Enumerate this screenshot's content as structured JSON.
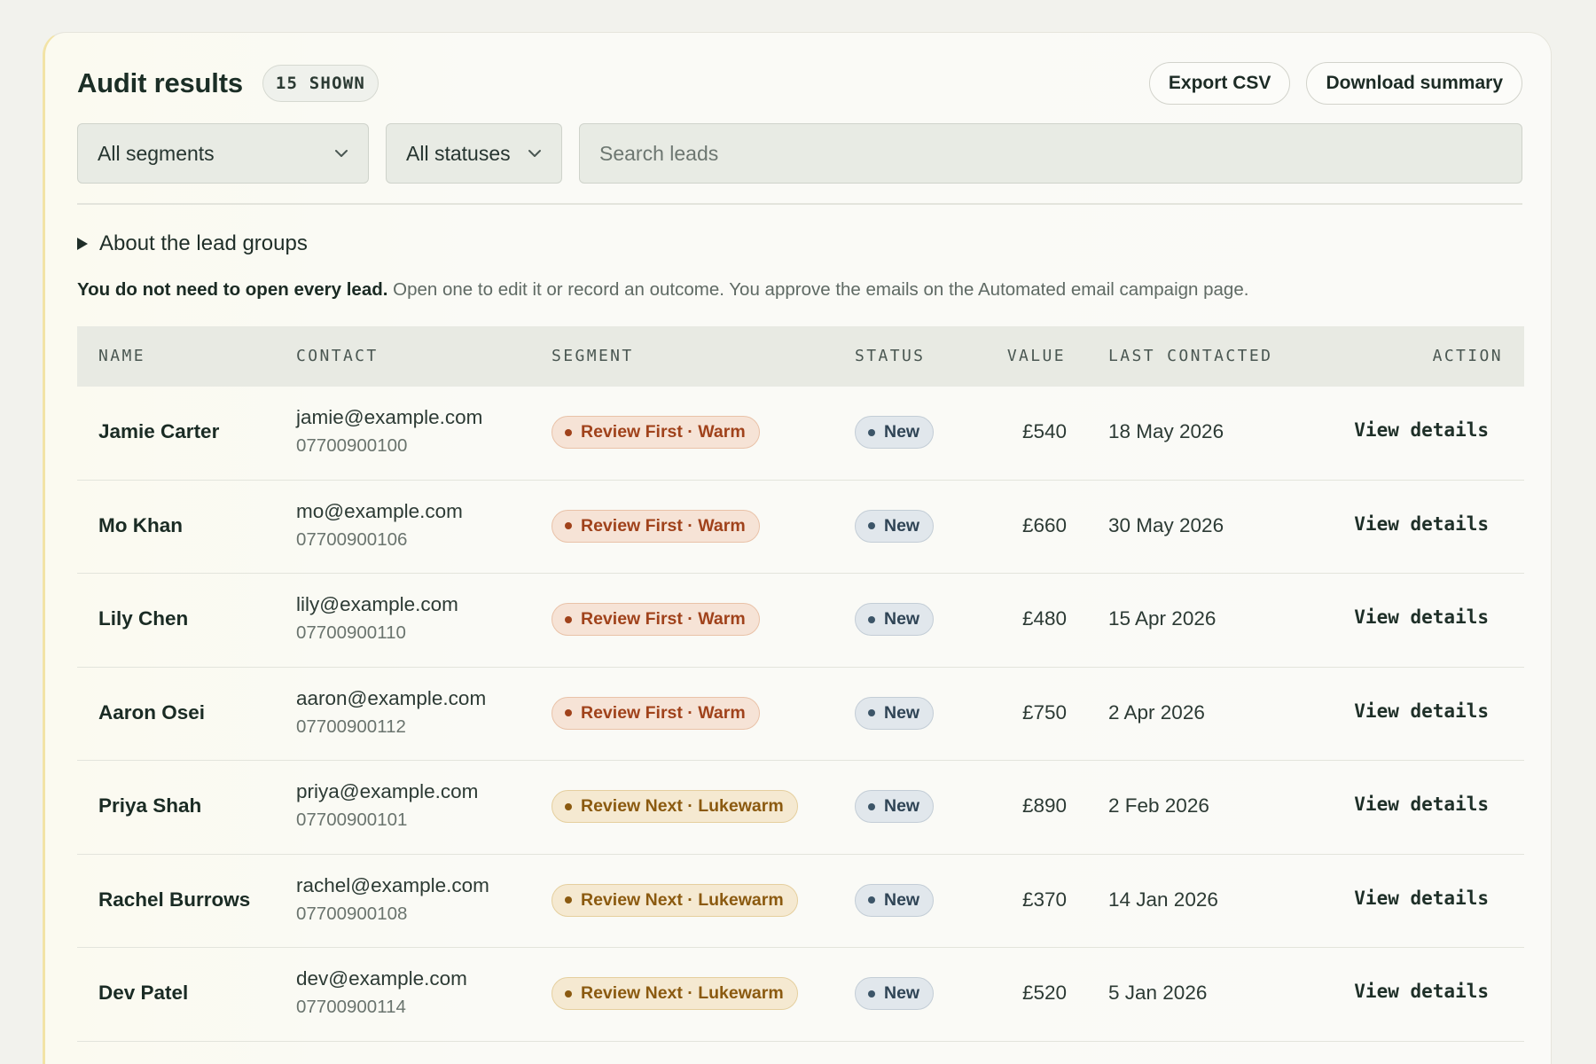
{
  "header": {
    "title": "Audit results",
    "count_badge": "15 SHOWN",
    "export_label": "Export CSV",
    "download_label": "Download summary"
  },
  "filters": {
    "segment_selected": "All segments",
    "status_selected": "All statuses",
    "search_placeholder": "Search leads"
  },
  "disclosure": {
    "label": "About the lead groups"
  },
  "note": {
    "bold": "You do not need to open every lead.",
    "rest": "Open one to edit it or record an outcome. You approve the emails on the Automated email campaign page."
  },
  "table": {
    "columns": [
      "NAME",
      "CONTACT",
      "SEGMENT",
      "STATUS",
      "VALUE",
      "LAST CONTACTED",
      "ACTION"
    ],
    "rows": [
      {
        "name": "Jamie Carter",
        "email": "jamie@example.com",
        "phone": "07700900100",
        "segment": "Review First · Warm",
        "segment_kind": "warm",
        "status": "New",
        "value": "£540",
        "last_contacted": "18 May 2026",
        "action": "View details"
      },
      {
        "name": "Mo Khan",
        "email": "mo@example.com",
        "phone": "07700900106",
        "segment": "Review First · Warm",
        "segment_kind": "warm",
        "status": "New",
        "value": "£660",
        "last_contacted": "30 May 2026",
        "action": "View details"
      },
      {
        "name": "Lily Chen",
        "email": "lily@example.com",
        "phone": "07700900110",
        "segment": "Review First · Warm",
        "segment_kind": "warm",
        "status": "New",
        "value": "£480",
        "last_contacted": "15 Apr 2026",
        "action": "View details"
      },
      {
        "name": "Aaron Osei",
        "email": "aaron@example.com",
        "phone": "07700900112",
        "segment": "Review First · Warm",
        "segment_kind": "warm",
        "status": "New",
        "value": "£750",
        "last_contacted": "2 Apr 2026",
        "action": "View details"
      },
      {
        "name": "Priya Shah",
        "email": "priya@example.com",
        "phone": "07700900101",
        "segment": "Review Next · Lukewarm",
        "segment_kind": "lukewarm",
        "status": "New",
        "value": "£890",
        "last_contacted": "2 Feb 2026",
        "action": "View details"
      },
      {
        "name": "Rachel Burrows",
        "email": "rachel@example.com",
        "phone": "07700900108",
        "segment": "Review Next · Lukewarm",
        "segment_kind": "lukewarm",
        "status": "New",
        "value": "£370",
        "last_contacted": "14 Jan 2026",
        "action": "View details"
      },
      {
        "name": "Dev Patel",
        "email": "dev@example.com",
        "phone": "07700900114",
        "segment": "Review Next · Lukewarm",
        "segment_kind": "lukewarm",
        "status": "New",
        "value": "£520",
        "last_contacted": "5 Jan 2026",
        "action": "View details"
      }
    ]
  },
  "icons": {
    "select_chevron": "chevron-down-icon",
    "disclosure": "triangle-right-icon"
  }
}
